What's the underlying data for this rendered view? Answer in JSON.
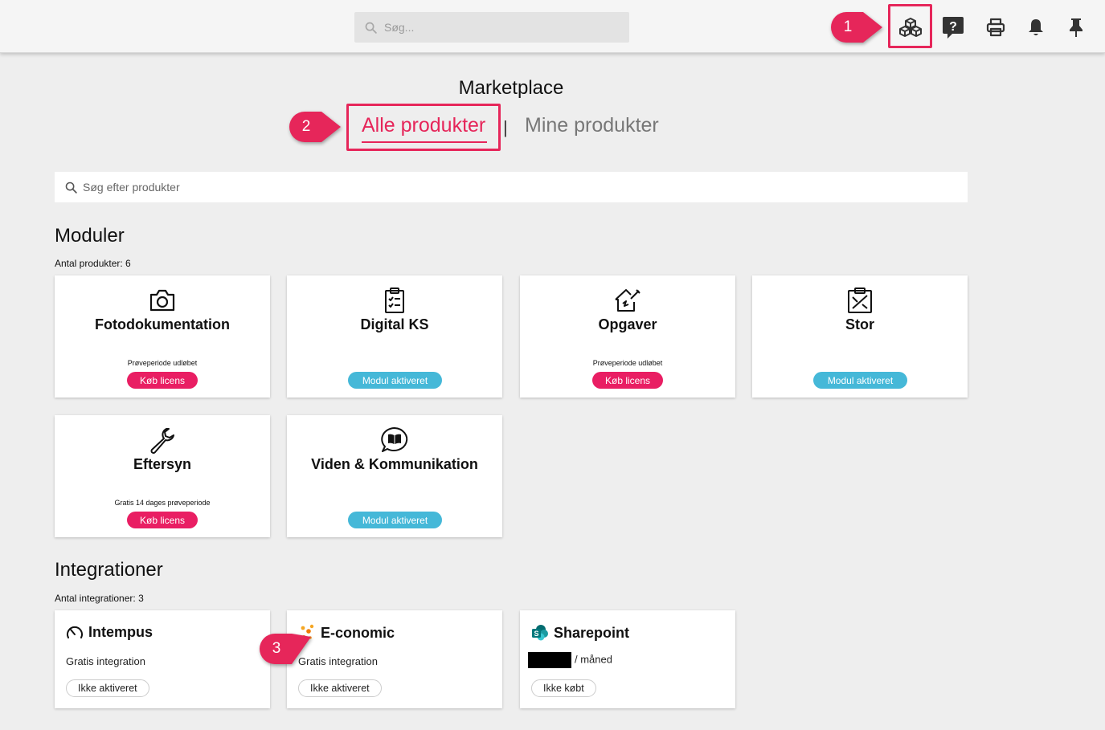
{
  "header": {
    "search_placeholder": "Søg...",
    "icons": [
      "cubes-icon",
      "help-icon",
      "print-icon",
      "bell-icon",
      "pin-icon"
    ]
  },
  "callouts": {
    "one": "1",
    "two": "2",
    "three": "3",
    "color": "#e6265a"
  },
  "marketplace": {
    "title": "Marketplace",
    "tab_all": "Alle produkter",
    "tab_separator": "|",
    "tab_mine": "Mine produkter",
    "search_placeholder": "Søg efter produkter"
  },
  "modules": {
    "title": "Moduler",
    "count_label": "Antal produkter: 6",
    "items": [
      {
        "name": "Fotodokumentation",
        "icon": "camera-icon",
        "status": "Prøveperiode udløbet",
        "button": "Køb licens"
      },
      {
        "name": "Digital KS",
        "icon": "clipboard-check-icon",
        "status": "",
        "button": "Modul aktiveret"
      },
      {
        "name": "Opgaver",
        "icon": "house-tools-icon",
        "status": "Prøveperiode udløbet",
        "button": "Køb licens"
      },
      {
        "name": "Stor",
        "icon": "clipboard-tools-icon",
        "status": "",
        "button": "Modul aktiveret"
      },
      {
        "name": "Eftersyn",
        "icon": "wrench-icon",
        "status": "Gratis 14 dages prøveperiode",
        "button": "Køb licens"
      },
      {
        "name": "Viden & Kommunikation",
        "icon": "chat-book-icon",
        "status": "",
        "button": "Modul aktiveret"
      }
    ]
  },
  "integrations": {
    "title": "Integrationer",
    "count_label": "Antal integrationer: 3",
    "items": [
      {
        "name": "Intempus",
        "icon": "speedometer-icon",
        "subtitle": "Gratis integration",
        "badge": "Ikke aktiveret"
      },
      {
        "name": "E-conomic",
        "icon": "e-conomic-logo-icon",
        "subtitle": "Gratis integration",
        "badge": "Ikke aktiveret"
      },
      {
        "name": "Sharepoint",
        "icon": "sharepoint-logo-icon",
        "subtitle": "/ måned",
        "badge": "Ikke købt"
      }
    ]
  },
  "colors": {
    "accent": "#e6265a",
    "buy": "#e91e63",
    "activated": "#45b8d8",
    "background": "#eeeeee"
  }
}
